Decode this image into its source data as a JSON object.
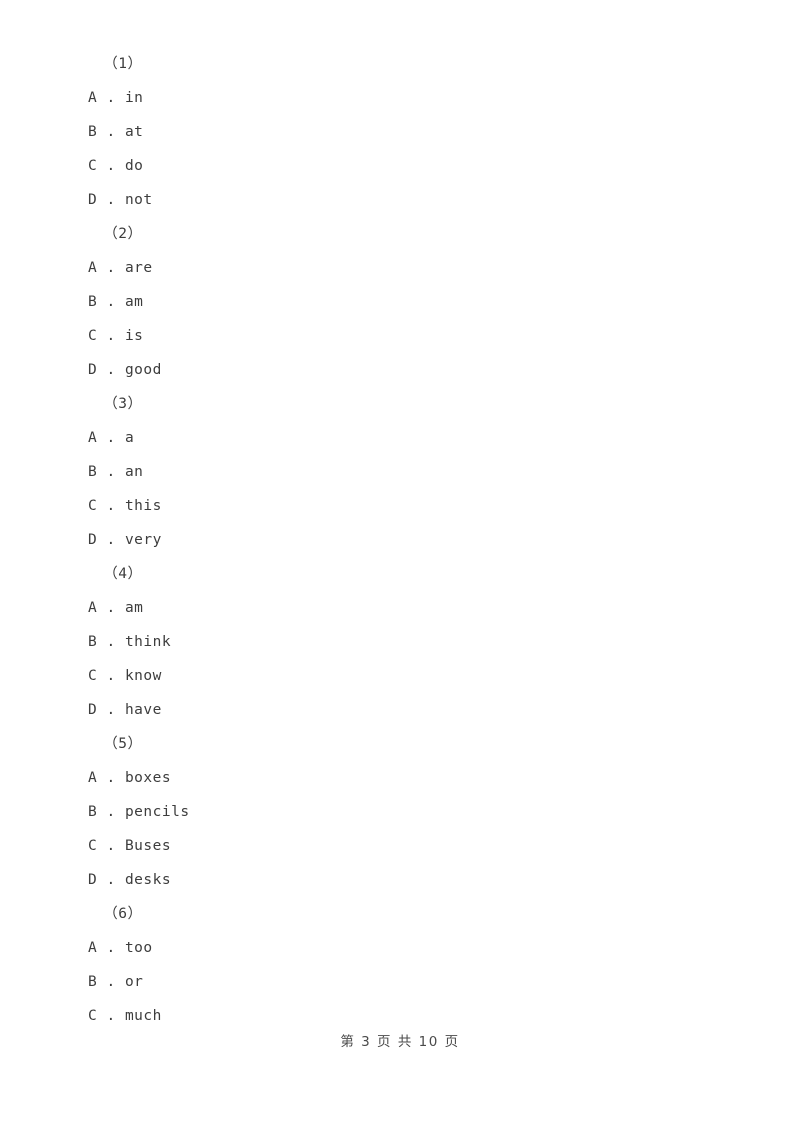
{
  "page": {
    "background_color": "#ffffff",
    "text_color": "#3d3d3d"
  },
  "questions": [
    {
      "number": " （1）",
      "options": [
        {
          "letter": "A",
          "separator": " . ",
          "text": "in"
        },
        {
          "letter": "B",
          "separator": " . ",
          "text": "at"
        },
        {
          "letter": "C",
          "separator": " . ",
          "text": "do"
        },
        {
          "letter": "D",
          "separator": " . ",
          "text": "not"
        }
      ]
    },
    {
      "number": " （2）",
      "options": [
        {
          "letter": "A",
          "separator": " . ",
          "text": "are"
        },
        {
          "letter": "B",
          "separator": " . ",
          "text": "am"
        },
        {
          "letter": "C",
          "separator": " . ",
          "text": "is"
        },
        {
          "letter": "D",
          "separator": " . ",
          "text": "good"
        }
      ]
    },
    {
      "number": " （3）",
      "options": [
        {
          "letter": "A",
          "separator": " . ",
          "text": "a"
        },
        {
          "letter": "B",
          "separator": " . ",
          "text": "an"
        },
        {
          "letter": "C",
          "separator": " . ",
          "text": "this"
        },
        {
          "letter": "D",
          "separator": " . ",
          "text": "very"
        }
      ]
    },
    {
      "number": " （4）",
      "options": [
        {
          "letter": "A",
          "separator": " . ",
          "text": "am"
        },
        {
          "letter": "B",
          "separator": " . ",
          "text": "think"
        },
        {
          "letter": "C",
          "separator": " . ",
          "text": "know"
        },
        {
          "letter": "D",
          "separator": " . ",
          "text": "have"
        }
      ]
    },
    {
      "number": " （5）",
      "options": [
        {
          "letter": "A",
          "separator": " . ",
          "text": "boxes"
        },
        {
          "letter": "B",
          "separator": " . ",
          "text": "pencils"
        },
        {
          "letter": "C",
          "separator": " . ",
          "text": "Buses"
        },
        {
          "letter": "D",
          "separator": " . ",
          "text": "desks"
        }
      ]
    },
    {
      "number": " （6）",
      "options": [
        {
          "letter": "A",
          "separator": " . ",
          "text": "too"
        },
        {
          "letter": "B",
          "separator": " . ",
          "text": "or"
        },
        {
          "letter": "C",
          "separator": " . ",
          "text": "much"
        }
      ]
    }
  ],
  "footer": {
    "text": "第 3 页 共 10 页",
    "current_page": "3",
    "total_pages": "10"
  }
}
